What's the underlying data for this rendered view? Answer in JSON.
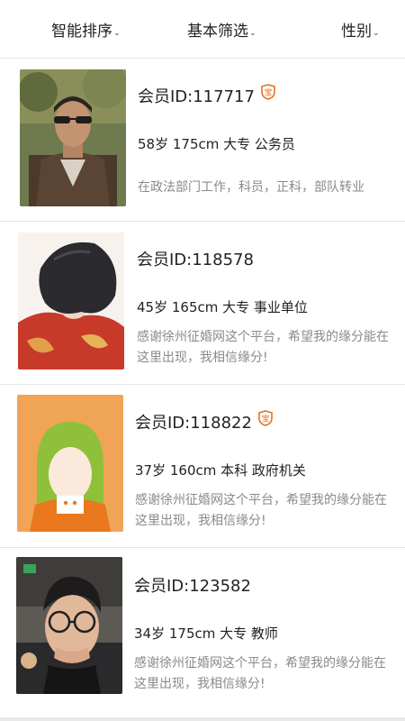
{
  "filters": {
    "sort_label": "智能排序",
    "basic_label": "基本筛选",
    "gender_label": "性别",
    "caret": "⌄"
  },
  "members": [
    {
      "id_text": "会员ID:117717",
      "verified": true,
      "info": "58岁 175cm 大专 公务员",
      "description": "在政法部门工作，科员，正科，部队转业",
      "photo": "man-sunglasses-outdoor"
    },
    {
      "id_text": "会员ID:118578",
      "verified": false,
      "info": "45岁 165cm 大专 事业单位",
      "description": "感谢徐州征婚网这个平台，希望我的缘分能在这里出现，我相信缘分!",
      "photo": "woman-short-black-hair"
    },
    {
      "id_text": "会员ID:118822",
      "verified": true,
      "info": "37岁 160cm 本科 政府机关",
      "description": "感谢徐州征婚网这个平台，希望我的缘分能在这里出现，我相信缘分!",
      "photo": "default-female-avatar"
    },
    {
      "id_text": "会员ID:123582",
      "verified": false,
      "info": "34岁 175cm 大专 教师",
      "description": "感谢徐州征婚网这个平台，希望我的缘分能在这里出现，我相信缘分!",
      "photo": "young-man-glasses-selfie"
    }
  ],
  "badge_glyph": "宝",
  "colors": {
    "badge": "#e8731c",
    "avatar_bg": "#f0a455",
    "hair_green": "#8fc03a"
  }
}
